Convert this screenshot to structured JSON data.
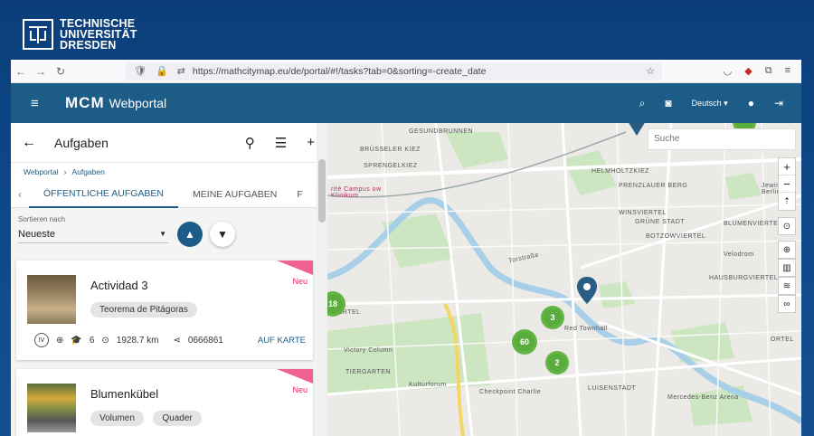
{
  "tud_logo": {
    "line1": "TECHNISCHE",
    "line2": "UNIVERSITÄT",
    "line3": "DRESDEN"
  },
  "browser": {
    "url": "https://mathcitymap.eu/de/portal/#!/tasks?tab=0&sorting=-create_date"
  },
  "appbar": {
    "logo_prefix": "MCM",
    "logo_suffix": "Webportal",
    "language": "Deutsch"
  },
  "panel": {
    "title": "Aufgaben",
    "breadcrumb": [
      "Webportal",
      "Aufgaben"
    ],
    "tabs": [
      "ÖFFENTLICHE AUFGABEN",
      "MEINE AUFGABEN",
      "F"
    ],
    "sort_label": "Sortieren nach",
    "sort_value": "Neueste"
  },
  "cards": [
    {
      "name": "Actividad 3",
      "tags": [
        "Teorema de Pitágoras"
      ],
      "badge": "Neu",
      "grade": "IV",
      "points": "6",
      "distance": "1928.7 km",
      "code": "0666861",
      "map_link": "AUF KARTE"
    },
    {
      "name": "Blumenkübel",
      "tags": [
        "Volumen",
        "Quader"
      ],
      "badge": "Neu"
    }
  ],
  "map": {
    "search_placeholder": "Suche",
    "labels": {
      "wedding": "GESUNDBRUNNEN",
      "bruessel": "BRÜSSELER KIEZ",
      "spreng": "SPRENGELKIEZ",
      "helm": "HELMHOLTZKIEZ",
      "prenz": "PRENZLAUER BERG",
      "jewish": "Jewish Ce Berlin-We",
      "winsviertel": "WINSVIERTEL",
      "gruen": "GRÜNE STADT",
      "botz": "BOTZOWVIERTEL",
      "blumen": "BLUMENVIERTEL",
      "velo": "Velodrom",
      "hausburg": "HAUSBURGVIERTEL",
      "torstrasse": "Torstraße",
      "campus": "rité Campus ow Klinikum",
      "rotes": "Red Townhall",
      "victory": "Victory Column",
      "tiergarten": "TIERGARTEN",
      "kultur": "Kulturforum",
      "checkpoint": "Checkpoint Charlie",
      "luisen": "LUISENSTADT",
      "mercedes": "Mercedes-Benz Arena",
      "viertel": "VIERTEL",
      "ortel": "ORTEL"
    },
    "clusters": [
      "18",
      "3",
      "60",
      "2"
    ]
  },
  "colors": {
    "brand": "#1d5c86",
    "badge": "#e91e63",
    "cluster": "#5aad3c"
  }
}
